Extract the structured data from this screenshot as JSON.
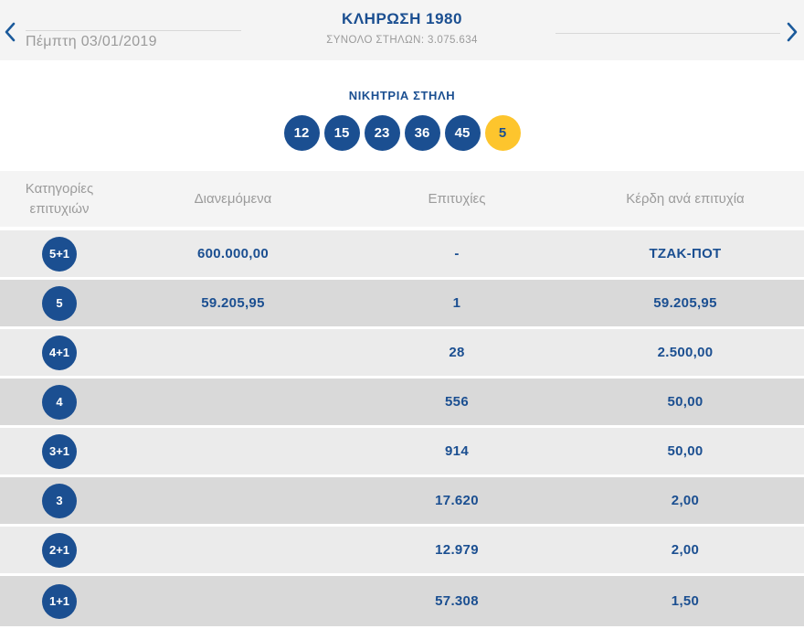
{
  "colors": {
    "accent_blue": "#1b4f91",
    "bonus_yellow": "#fdc52d",
    "muted_text": "#9b9b9b",
    "bar_bg": "#f4f4f4",
    "row_light": "#ebebeb",
    "row_dark": "#d9d9d9"
  },
  "header": {
    "prev_icon": "chevron-left",
    "next_icon": "chevron-right",
    "date": "Πέμπτη 03/01/2019",
    "title": "ΚΛΗΡΩΣΗ 1980",
    "subtitle": "ΣΥΝΟΛΟ ΣΤΗΛΩΝ: 3.075.634"
  },
  "winning": {
    "label": "ΝΙΚΗΤΡΙΑ ΣΤΗΛΗ",
    "numbers": [
      {
        "value": "12",
        "type": "main"
      },
      {
        "value": "15",
        "type": "main"
      },
      {
        "value": "23",
        "type": "main"
      },
      {
        "value": "36",
        "type": "main"
      },
      {
        "value": "45",
        "type": "main"
      },
      {
        "value": "5",
        "type": "bonus"
      }
    ]
  },
  "table": {
    "headers": [
      "Κατηγορίες επιτυχιών",
      "Διανεμόμενα",
      "Επιτυχίες",
      "Κέρδη ανά επιτυχία"
    ],
    "rows": [
      {
        "category": "5+1",
        "distributed": "600.000,00",
        "wins": "-",
        "prize": "ΤΖΑΚ-ΠΟΤ"
      },
      {
        "category": "5",
        "distributed": "59.205,95",
        "wins": "1",
        "prize": "59.205,95"
      },
      {
        "category": "4+1",
        "distributed": "",
        "wins": "28",
        "prize": "2.500,00"
      },
      {
        "category": "4",
        "distributed": "",
        "wins": "556",
        "prize": "50,00"
      },
      {
        "category": "3+1",
        "distributed": "",
        "wins": "914",
        "prize": "50,00"
      },
      {
        "category": "3",
        "distributed": "",
        "wins": "17.620",
        "prize": "2,00"
      },
      {
        "category": "2+1",
        "distributed": "",
        "wins": "12.979",
        "prize": "2,00"
      },
      {
        "category": "1+1",
        "distributed": "",
        "wins": "57.308",
        "prize": "1,50"
      }
    ]
  }
}
